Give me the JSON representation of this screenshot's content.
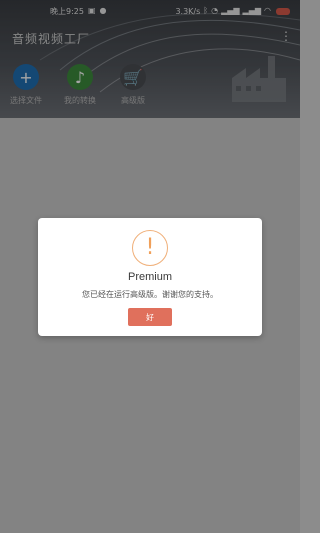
{
  "status_bar": {
    "time": "晚上9:25",
    "network_speed": "3.3K/s",
    "battery": "28",
    "icons": [
      "image-icon",
      "wechat-icon",
      "bluetooth-icon",
      "alarm-icon",
      "signal-icon",
      "signal-icon",
      "wifi-icon",
      "battery-icon"
    ]
  },
  "header": {
    "title": "音频视频工厂",
    "menu_glyph": "⋮"
  },
  "actions": [
    {
      "label": "选择文件",
      "icon": "plus-icon",
      "color": "#1f6fb2",
      "glyph": "+"
    },
    {
      "label": "我的转换",
      "icon": "music-file-icon",
      "color": "#3d8a3d",
      "glyph": "♪"
    },
    {
      "label": "高级版",
      "icon": "cart-icon",
      "color": "#4a4d52",
      "glyph": "🛒"
    }
  ],
  "dialog": {
    "icon": "warning-icon",
    "icon_glyph": "!",
    "title": "Premium",
    "message": "您已经在运行高级版。谢谢您的支持。",
    "ok_label": "好"
  },
  "colors": {
    "ok_button": "#e0705c",
    "warning": "#f0a05a"
  }
}
